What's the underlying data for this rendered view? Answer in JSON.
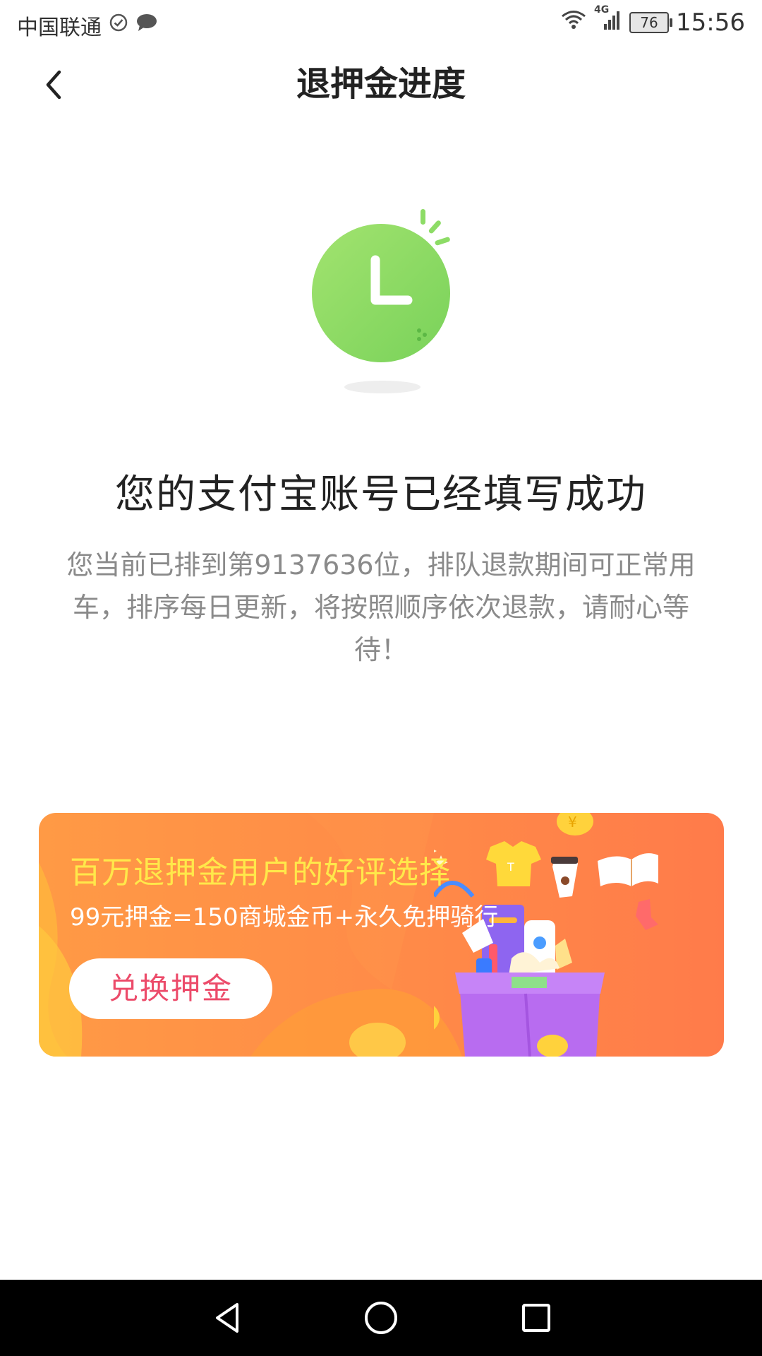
{
  "status_bar": {
    "carrier": "中国联通",
    "network": "4G",
    "battery": "76",
    "time": "15:56"
  },
  "nav": {
    "title": "退押金进度",
    "back_icon": "chevron-left-icon"
  },
  "illustration": {
    "icon": "clock-icon",
    "color": "#8ddc66"
  },
  "message": {
    "headline": "您的支付宝账号已经填写成功",
    "description": "您当前已排到第9137636位，排队退款期间可正常用车，排序每日更新，将按照顺序依次退款，请耐心等待！"
  },
  "promo": {
    "title": "百万退押金用户的好评选择",
    "subtitle": "99元押金=150商城金币+永久免押骑行",
    "button_label": "兑换押金",
    "title_color": "#ffe84a",
    "button_text_color": "#ec4b6a",
    "background_color": "#ff8a48"
  },
  "system_nav": {
    "back_icon": "triangle-back-icon",
    "home_icon": "circle-home-icon",
    "recents_icon": "square-recents-icon"
  }
}
